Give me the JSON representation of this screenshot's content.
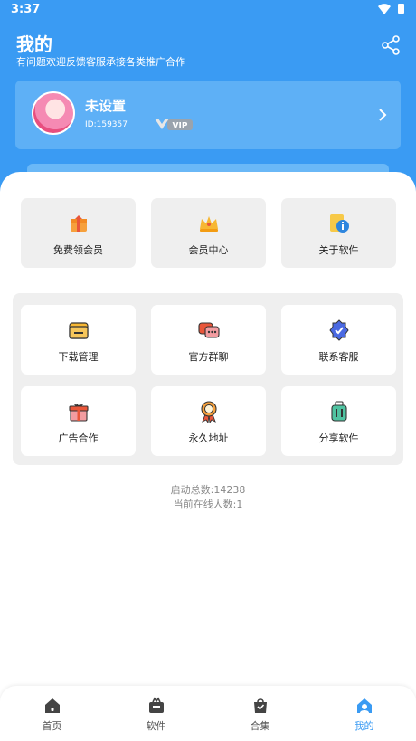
{
  "status_bar": {
    "time": "3:37"
  },
  "header": {
    "title": "我的",
    "subtitle": "有问题欢迎反馈客服承接各类推广合作",
    "share_icon": "share-icon"
  },
  "profile": {
    "name": "未设置",
    "id_text": "ID:159357",
    "badge_text": "VIP"
  },
  "top_tiles": [
    {
      "label": "免费领会员",
      "icon": "gift-box-icon"
    },
    {
      "label": "会员中心",
      "icon": "crown-icon"
    },
    {
      "label": "关于软件",
      "icon": "info-card-icon"
    }
  ],
  "panel_tiles": [
    {
      "label": "下载管理",
      "icon": "folder-icon"
    },
    {
      "label": "官方群聊",
      "icon": "chat-icon"
    },
    {
      "label": "联系客服",
      "icon": "verified-badge-icon"
    },
    {
      "label": "广告合作",
      "icon": "gift-icon"
    },
    {
      "label": "永久地址",
      "icon": "medal-icon"
    },
    {
      "label": "分享软件",
      "icon": "suitcase-icon"
    }
  ],
  "stats": {
    "launch_count": "启动总数:14238",
    "online_count": "当前在线人数:1"
  },
  "bottom_nav": [
    {
      "label": "首页",
      "icon": "home-icon",
      "active": false
    },
    {
      "label": "软件",
      "icon": "software-box-icon",
      "active": false
    },
    {
      "label": "合集",
      "icon": "bag-icon",
      "active": false
    },
    {
      "label": "我的",
      "icon": "profile-house-icon",
      "active": true
    }
  ],
  "colors": {
    "primary": "#3a9bf3",
    "card": "#5eb0f6",
    "tile_bg": "#efefef",
    "text_dark": "#222222",
    "text_muted": "#888888"
  }
}
